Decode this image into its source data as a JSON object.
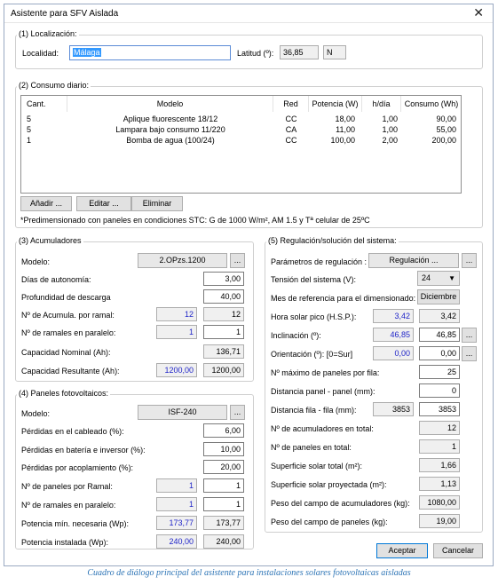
{
  "window": {
    "title": "Asistente para SFV Aislada",
    "close": "✕"
  },
  "localizacion": {
    "group_label": "(1) Localización:",
    "localidad_label": "Localidad:",
    "localidad_value": "Málaga",
    "latitud_label": "Latitud (º):",
    "latitud_value": "36,85",
    "hemisferio": "N"
  },
  "consumo": {
    "group_label": "(2) Consumo diario:",
    "columns": [
      "Cant.",
      "Modelo",
      "Red",
      "Potencia (W)",
      "h/día",
      "Consumo (Wh)"
    ],
    "rows": [
      [
        "5",
        "Aplique fluorescente 18/12",
        "CC",
        "18,00",
        "1,00",
        "90,00"
      ],
      [
        "5",
        "Lampara bajo consumo 11/220",
        "CA",
        "11,00",
        "1,00",
        "55,00"
      ],
      [
        "1",
        "Bomba de agua (100/24)",
        "CC",
        "100,00",
        "2,00",
        "200,00"
      ]
    ],
    "add_btn": "Añadir ...",
    "edit_btn": "Editar ...",
    "delete_btn": "Eliminar",
    "note": "*Predimensionado con paneles en condiciones STC: G de 1000 W/m², AM 1.5 y Tª celular de 25ºC"
  },
  "acumuladores": {
    "group_label": "(3) Acumuladores",
    "modelo_label": "Modelo:",
    "modelo_value": "2.OPzs.1200",
    "dots": "...",
    "autonomia_label": "Días de autonomía:",
    "autonomia_value": "3,00",
    "profundidad_label": "Profundidad de descarga",
    "profundidad_value": "40,00",
    "acum_ramal_label": "Nº de Acumula. por ramal:",
    "acum_ramal_calc": "12",
    "acum_ramal_value": "12",
    "ramales_label": "Nº de ramales en paralelo:",
    "ramales_calc": "1",
    "ramales_value": "1",
    "cap_nominal_label": "Capacidad Nominal (Ah):",
    "cap_nominal_value": "136,71",
    "cap_result_label": "Capacidad Resultante (Ah):",
    "cap_result_calc": "1200,00",
    "cap_result_value": "1200,00"
  },
  "paneles": {
    "group_label": "(4) Paneles fotovoltaicos:",
    "modelo_label": "Modelo:",
    "modelo_value": "ISF-240",
    "dots": "...",
    "perd_cableado_label": "Pérdidas en el cableado (%):",
    "perd_cableado_value": "6,00",
    "perd_bateria_label": "Pérdidas en batería e inversor (%):",
    "perd_bateria_value": "10,00",
    "perd_acoplamiento_label": "Pérdidas por acoplamiento (%):",
    "perd_acoplamiento_value": "20,00",
    "paneles_ramal_label": "Nº de paneles por Ramal:",
    "paneles_ramal_calc": "1",
    "paneles_ramal_value": "1",
    "ramales_label": "Nº de ramales en paralelo:",
    "ramales_calc": "1",
    "ramales_value": "1",
    "pot_min_label": "Potencia mín. necesaria (Wp):",
    "pot_min_calc": "173,77",
    "pot_min_value": "173,77",
    "pot_inst_label": "Potencia instalada (Wp):",
    "pot_inst_calc": "240,00",
    "pot_inst_value": "240,00"
  },
  "regulacion": {
    "group_label": "(5) Regulación/solución del sistema:",
    "param_label": "Parámetros de regulación :",
    "param_btn": "Regulación ...",
    "dots": "...",
    "tension_label": "Tensión del sistema (V):",
    "tension_value": "24",
    "mes_label": "Mes de referencia para el dimensionado:",
    "mes_value": "Diciembre",
    "hsp_label": "Hora solar pico (H.S.P.):",
    "hsp_calc": "3,42",
    "hsp_value": "3,42",
    "inclinacion_label": "Inclinación (º):",
    "inclinacion_calc": "46,85",
    "inclinacion_value": "46,85",
    "orientacion_label": "Orientación (º): [0=Sur]",
    "orientacion_calc": "0,00",
    "orientacion_value": "0,00",
    "max_paneles_label": "Nº máximo de paneles por fila:",
    "max_paneles_value": "25",
    "dist_panel_label": "Distancia panel - panel (mm):",
    "dist_panel_value": "0",
    "dist_fila_label": "Distancia fila - fila (mm):",
    "dist_fila_calc": "3853",
    "dist_fila_value": "3853",
    "n_acum_label": "Nº de acumuladores en total:",
    "n_acum_value": "12",
    "n_paneles_label": "Nº de paneles en total:",
    "n_paneles_value": "1",
    "sup_total_label": "Superficie solar total (m²):",
    "sup_total_value": "1,66",
    "sup_proy_label": "Superficie solar proyectada (m²):",
    "sup_proy_value": "1,13",
    "peso_acum_label": "Peso del campo de acumuladores (kg):",
    "peso_acum_value": "1080,00",
    "peso_paneles_label": "Peso del campo de paneles (kg):",
    "peso_paneles_value": "19,00"
  },
  "footer": {
    "accept": "Aceptar",
    "cancel": "Cancelar"
  },
  "caption": "Cuadro de diálogo principal del asistente para instalaciones solares fotovoltaicas aisladas"
}
